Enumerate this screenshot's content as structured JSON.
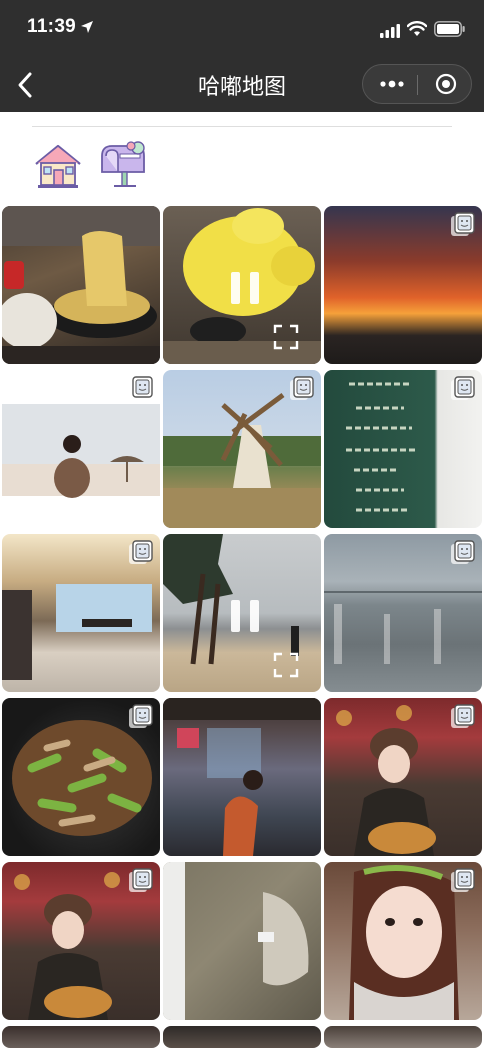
{
  "status_bar": {
    "time": "11:39"
  },
  "nav": {
    "title": "哈嘟地图"
  },
  "toolbar": {
    "items": [
      {
        "name": "home-icon"
      },
      {
        "name": "mailbox-icon"
      }
    ]
  },
  "gallery": {
    "items": [
      {
        "type": "photo",
        "subject": "noodles"
      },
      {
        "type": "video",
        "subject": "yellow-plush"
      },
      {
        "type": "photo",
        "subject": "sunset"
      },
      {
        "type": "photo",
        "subject": "beach-portrait"
      },
      {
        "type": "photo",
        "subject": "windmill"
      },
      {
        "type": "photo",
        "subject": "chalkboard"
      },
      {
        "type": "photo",
        "subject": "lobby"
      },
      {
        "type": "video",
        "subject": "beach-trees"
      },
      {
        "type": "photo",
        "subject": "city-aerial"
      },
      {
        "type": "photo",
        "subject": "stir-fry"
      },
      {
        "type": "photo",
        "subject": "mall-portrait"
      },
      {
        "type": "photo",
        "subject": "restaurant-portrait"
      },
      {
        "type": "photo",
        "subject": "restaurant-portrait-2"
      },
      {
        "type": "photo",
        "subject": "cushion"
      },
      {
        "type": "photo",
        "subject": "selfie"
      },
      {
        "type": "photo",
        "subject": "partial"
      },
      {
        "type": "photo",
        "subject": "partial"
      },
      {
        "type": "photo",
        "subject": "partial"
      }
    ]
  }
}
